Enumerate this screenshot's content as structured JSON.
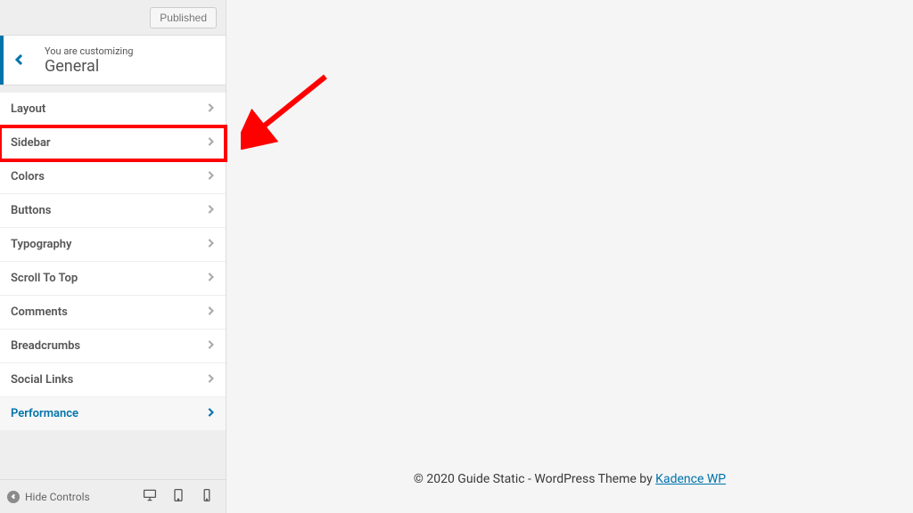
{
  "top": {
    "published_label": "Published"
  },
  "header": {
    "eyebrow": "You are customizing",
    "title": "General"
  },
  "menu": {
    "items": [
      {
        "label": "Layout",
        "active": false,
        "highlight": false
      },
      {
        "label": "Sidebar",
        "active": false,
        "highlight": true
      },
      {
        "label": "Colors",
        "active": false,
        "highlight": false
      },
      {
        "label": "Buttons",
        "active": false,
        "highlight": false
      },
      {
        "label": "Typography",
        "active": false,
        "highlight": false
      },
      {
        "label": "Scroll To Top",
        "active": false,
        "highlight": false
      },
      {
        "label": "Comments",
        "active": false,
        "highlight": false
      },
      {
        "label": "Breadcrumbs",
        "active": false,
        "highlight": false
      },
      {
        "label": "Social Links",
        "active": false,
        "highlight": false
      },
      {
        "label": "Performance",
        "active": true,
        "highlight": false
      }
    ]
  },
  "footer": {
    "hide_controls_label": "Hide Controls"
  },
  "preview": {
    "footer_prefix": "© 2020 Guide Static - WordPress Theme by ",
    "footer_link_text": "Kadence WP"
  },
  "annotation": {
    "arrow_color": "#ff0000"
  }
}
